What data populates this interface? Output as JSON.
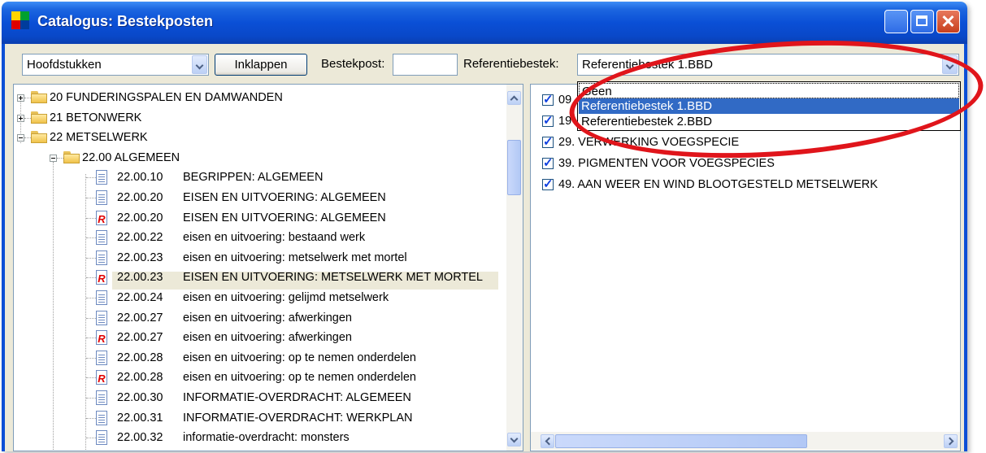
{
  "window": {
    "title": "Catalogus: Bestekposten",
    "colors": {
      "titlebar": "#0a4fd6",
      "selection": "#316ac5",
      "highlight_ellipse": "#e0151b"
    }
  },
  "toolbar": {
    "view_select": {
      "value": "Hoofdstukken"
    },
    "collapse_button": "Inklappen",
    "bestekpost_label": "Bestekpost:",
    "bestekpost_value": "",
    "referentie_label": "Referentiebestek:",
    "referentie_select": {
      "value": "Referentiebestek 1.BBD"
    }
  },
  "dropdown": {
    "options": [
      "Geen",
      "Referentiebestek 1.BBD",
      "Referentiebestek 2.BBD"
    ],
    "selected": "Referentiebestek 1.BBD"
  },
  "tree": {
    "chapters": [
      {
        "label": "20 FUNDERINGSPALEN EN DAMWANDEN",
        "expanded": false
      },
      {
        "label": "21 BETONWERK",
        "expanded": false
      },
      {
        "label": "22 METSELWERK",
        "expanded": true
      }
    ],
    "section": {
      "label": "22.00 ALGEMEEN",
      "expanded": true
    },
    "items": [
      {
        "code": "22.00.10",
        "text": "BEGRIPPEN: ALGEMEEN",
        "icon": "document-icon"
      },
      {
        "code": "22.00.20",
        "text": "EISEN EN UITVOERING: ALGEMEEN",
        "icon": "document-icon"
      },
      {
        "code": "22.00.20",
        "text": "EISEN EN UITVOERING: ALGEMEEN",
        "icon": "reference-document-icon"
      },
      {
        "code": "22.00.22",
        "text": "eisen en uitvoering: bestaand werk",
        "icon": "document-icon"
      },
      {
        "code": "22.00.23",
        "text": "eisen en uitvoering: metselwerk met mortel",
        "icon": "document-icon"
      },
      {
        "code": "22.00.23",
        "text": "EISEN EN UITVOERING: METSELWERK MET MORTEL",
        "icon": "reference-document-icon",
        "selected": true
      },
      {
        "code": "22.00.24",
        "text": "eisen en uitvoering: gelijmd metselwerk",
        "icon": "document-icon"
      },
      {
        "code": "22.00.27",
        "text": "eisen en uitvoering: afwerkingen",
        "icon": "document-icon"
      },
      {
        "code": "22.00.27",
        "text": "eisen en uitvoering: afwerkingen",
        "icon": "reference-document-icon"
      },
      {
        "code": "22.00.28",
        "text": "eisen en uitvoering: op te nemen onderdelen",
        "icon": "document-icon"
      },
      {
        "code": "22.00.28",
        "text": "eisen en uitvoering: op te nemen onderdelen",
        "icon": "reference-document-icon"
      },
      {
        "code": "22.00.30",
        "text": "INFORMATIE-OVERDRACHT: ALGEMEEN",
        "icon": "document-icon"
      },
      {
        "code": "22.00.31",
        "text": "INFORMATIE-OVERDRACHT: WERKPLAN",
        "icon": "document-icon"
      },
      {
        "code": "22.00.32",
        "text": "informatie-overdracht: monsters",
        "icon": "document-icon"
      }
    ]
  },
  "right_list": {
    "items": [
      {
        "label": "09",
        "checked": true
      },
      {
        "label": "19",
        "checked": true
      },
      {
        "label": "29. VERWERKING VOEGSPECIE",
        "checked": true
      },
      {
        "label": "39. PIGMENTEN VOOR VOEGSPECIES",
        "checked": true
      },
      {
        "label": "49. AAN WEER EN WIND BLOOTGESTELD METSELWERK",
        "checked": true
      }
    ]
  }
}
